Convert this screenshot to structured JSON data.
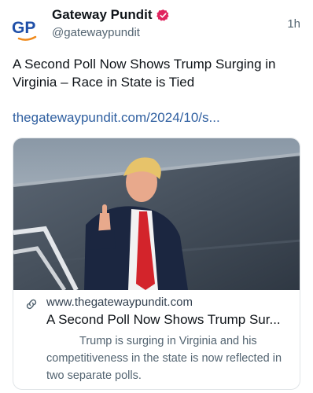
{
  "author": {
    "avatar_text": "GP",
    "display_name": "Gateway Pundit",
    "handle": "@gatewaypundit",
    "verified_icon": "verified-badge-icon"
  },
  "post": {
    "time": "1h",
    "text": "A Second Poll Now Shows Trump Surging in Virginia – Race in State is Tied",
    "link": "thegatewaypundit.com/2024/10/s..."
  },
  "card": {
    "domain": "www.thegatewaypundit.com",
    "title": "A Second Poll Now Shows Trump Sur...",
    "description": "Trump is surging in Virginia and his competitiveness in the state is now reflected in two separate polls.",
    "link_icon": "link-icon"
  },
  "colors": {
    "link": "#2f5fa0",
    "verified": "#e0245e",
    "avatar_blue": "#1f4fa8",
    "avatar_orange": "#f08a1c"
  }
}
